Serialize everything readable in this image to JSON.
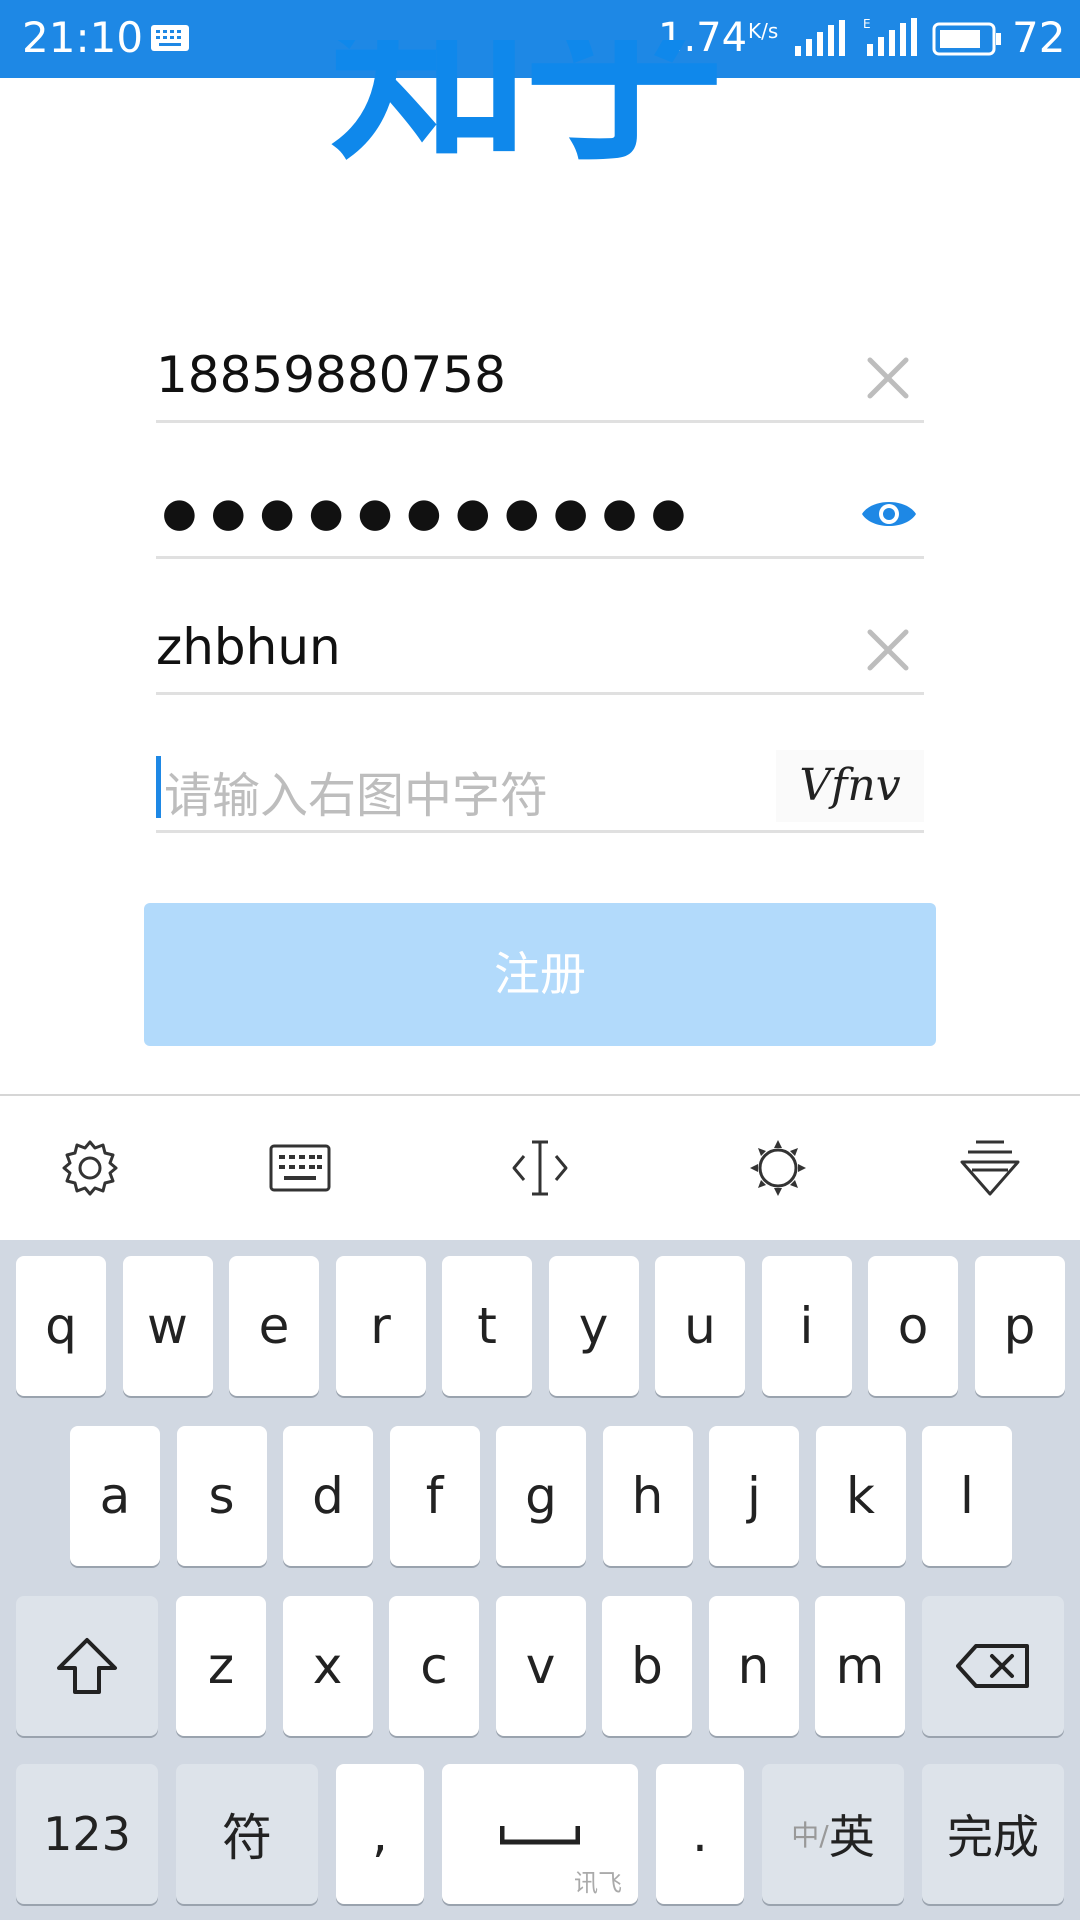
{
  "status_bar": {
    "time": "21:10",
    "speed": "1.74",
    "speed_unit": "K/s",
    "battery": "72",
    "icons": [
      "keyboard-icon",
      "signal-icon",
      "signal-4g-icon",
      "battery-icon"
    ]
  },
  "logo": {
    "text": "知乎",
    "color": "#0f88eb"
  },
  "form": {
    "phone": "18859880758",
    "password_mask": "●●●●●●●●●●●",
    "username": "zhbhun",
    "captcha_placeholder": "请输入右图中字符",
    "captcha_image_text": "Vfnv",
    "register_label": "注册"
  },
  "toolbar": {
    "icons": [
      "settings-gear-icon",
      "keyboard-icon",
      "cursor-move-icon",
      "skin-sun-icon",
      "hide-keyboard-icon"
    ]
  },
  "keyboard": {
    "row1": [
      "q",
      "w",
      "e",
      "r",
      "t",
      "y",
      "u",
      "i",
      "o",
      "p"
    ],
    "row2": [
      "a",
      "s",
      "d",
      "f",
      "g",
      "h",
      "j",
      "k",
      "l"
    ],
    "row3": [
      "z",
      "x",
      "c",
      "v",
      "b",
      "n",
      "m"
    ],
    "numbers_label": "123",
    "symbol_label": "符",
    "comma_label": ",",
    "space_sub_label": "讯飞",
    "period_label": ".",
    "lang_small": "中/",
    "lang_main": "英",
    "done_label": "完成"
  },
  "colors": {
    "accent": "#1e88e5",
    "button_disabled": "#b2dafb",
    "keyboard_bg": "#d1d8e2"
  }
}
